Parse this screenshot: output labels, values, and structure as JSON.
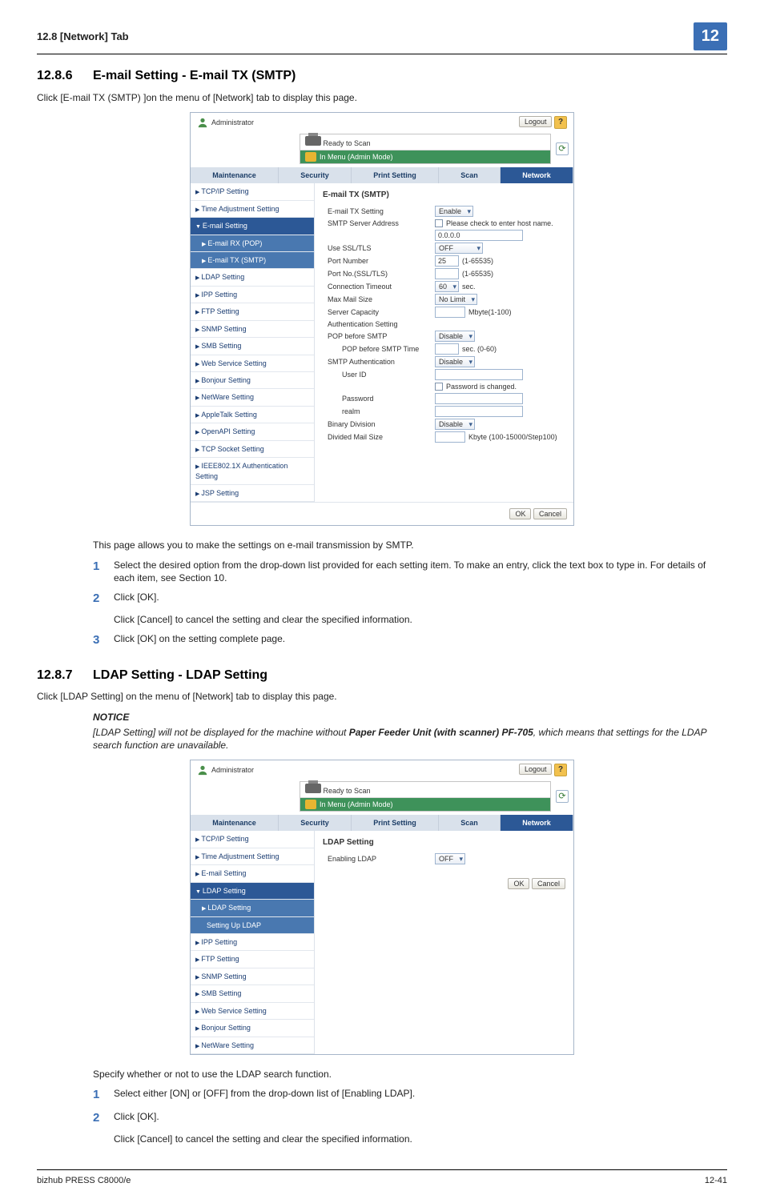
{
  "header": {
    "left": "12.8    [Network] Tab",
    "chapter": "12"
  },
  "s1": {
    "num": "12.8.6",
    "title": "E-mail Setting - E-mail TX (SMTP)",
    "intro": "Click [E-mail TX (SMTP) ]on the menu of [Network] tab to display this page.",
    "afterpanel": "This page allows you to make the settings on e-mail transmission by SMTP.",
    "step1": "Select the desired option from the drop-down list provided for each setting item. To make an entry, click the text box to type in. For details of each item, see Section 10.",
    "step2": "Click [OK].",
    "step2b": "Click [Cancel] to cancel the setting and clear the specified information.",
    "step3": "Click [OK] on the setting complete page."
  },
  "s2": {
    "num": "12.8.7",
    "title": "LDAP Setting - LDAP Setting",
    "intro": "Click [LDAP Setting] on the menu of [Network] tab to display this page.",
    "notice_label": "NOTICE",
    "notice_body_a": "[LDAP Setting] will not be displayed for the machine without ",
    "notice_bold": "Paper Feeder Unit (with scanner) PF-705",
    "notice_body_b": ", which means that settings for the LDAP search function are unavailable.",
    "afterpanel": "Specify whether or not to use the LDAP search function.",
    "step1": "Select either [ON] or [OFF] from the drop-down list of [Enabling LDAP].",
    "step2": "Click [OK].",
    "step2b": "Click [Cancel] to cancel the setting and clear the specified information."
  },
  "panel_common": {
    "admin": "Administrator",
    "logout": "Logout",
    "help": "?",
    "ready": "Ready to Scan",
    "menu_mode": "In Menu (Admin Mode)",
    "tabs": {
      "maintenance": "Maintenance",
      "security": "Security",
      "print": "Print Setting",
      "scan": "Scan",
      "network": "Network"
    },
    "ok": "OK",
    "cancel": "Cancel",
    "refresh": "⟳"
  },
  "panel1": {
    "sidebar": [
      {
        "l": "TCP/IP Setting",
        "t": "tri"
      },
      {
        "l": "Time Adjustment Setting",
        "t": "tri"
      },
      {
        "l": "E-mail Setting",
        "t": "parent"
      },
      {
        "l": "E-mail RX (POP)",
        "t": "child"
      },
      {
        "l": "E-mail TX (SMTP)",
        "t": "child"
      },
      {
        "l": "LDAP Setting",
        "t": "tri"
      },
      {
        "l": "IPP Setting",
        "t": "tri"
      },
      {
        "l": "FTP Setting",
        "t": "tri"
      },
      {
        "l": "SNMP Setting",
        "t": "tri"
      },
      {
        "l": "SMB Setting",
        "t": "tri"
      },
      {
        "l": "Web Service Setting",
        "t": "tri"
      },
      {
        "l": "Bonjour Setting",
        "t": "tri"
      },
      {
        "l": "NetWare Setting",
        "t": "tri"
      },
      {
        "l": "AppleTalk Setting",
        "t": "tri"
      },
      {
        "l": "OpenAPI Setting",
        "t": "tri"
      },
      {
        "l": "TCP Socket Setting",
        "t": "tri"
      },
      {
        "l": "IEEE802.1X Authentication Setting",
        "t": "tri"
      },
      {
        "l": "JSP Setting",
        "t": "tri"
      }
    ],
    "title": "E-mail TX (SMTP)",
    "fields": {
      "tx_setting": {
        "lab": "E-mail TX Setting",
        "val": "Enable"
      },
      "server_addr": {
        "lab": "SMTP Server Address",
        "chk": "Please check to enter host name.",
        "val": "0.0.0.0"
      },
      "use_ssl": {
        "lab": "Use SSL/TLS",
        "val": "OFF"
      },
      "port": {
        "lab": "Port Number",
        "val": "25",
        "hint": "(1-65535)"
      },
      "port_ssl": {
        "lab": "Port No.(SSL/TLS)",
        "val": "",
        "hint": "(1-65535)"
      },
      "timeout": {
        "lab": "Connection Timeout",
        "val": "60",
        "unit": "sec."
      },
      "max_mail": {
        "lab": "Max Mail Size",
        "val": "No Limit"
      },
      "capacity": {
        "lab": "Server Capacity",
        "val": "",
        "unit": "Mbyte(1-100)"
      },
      "auth": {
        "lab": "Authentication Setting"
      },
      "pop_before": {
        "lab": "POP before SMTP",
        "val": "Disable"
      },
      "pop_time": {
        "lab": "POP before SMTP Time",
        "val": "",
        "unit": "sec. (0-60)"
      },
      "smtp_auth": {
        "lab": "SMTP Authentication",
        "val": "Disable"
      },
      "uid": {
        "lab": "User ID"
      },
      "pwchk": {
        "lab": "Password is changed."
      },
      "pw": {
        "lab": "Password"
      },
      "realm": {
        "lab": "realm"
      },
      "binary": {
        "lab": "Binary Division",
        "val": "Disable"
      },
      "div": {
        "lab": "Divided Mail Size",
        "val": "",
        "unit": "Kbyte (100-15000/Step100)"
      }
    }
  },
  "panel2": {
    "sidebar": [
      {
        "l": "TCP/IP Setting",
        "t": "tri"
      },
      {
        "l": "Time Adjustment Setting",
        "t": "tri"
      },
      {
        "l": "E-mail Setting",
        "t": "tri"
      },
      {
        "l": "LDAP Setting",
        "t": "parent"
      },
      {
        "l": "LDAP Setting",
        "t": "child"
      },
      {
        "l": "Setting Up LDAP",
        "t": "childplain"
      },
      {
        "l": "IPP Setting",
        "t": "tri"
      },
      {
        "l": "FTP Setting",
        "t": "tri"
      },
      {
        "l": "SNMP Setting",
        "t": "tri"
      },
      {
        "l": "SMB Setting",
        "t": "tri"
      },
      {
        "l": "Web Service Setting",
        "t": "tri"
      },
      {
        "l": "Bonjour Setting",
        "t": "tri"
      },
      {
        "l": "NetWare Setting",
        "t": "tri"
      }
    ],
    "title": "LDAP Setting",
    "enabling": {
      "lab": "Enabling LDAP",
      "val": "OFF"
    }
  },
  "footer": {
    "product": "bizhub PRESS C8000/e",
    "page": "12-41"
  }
}
